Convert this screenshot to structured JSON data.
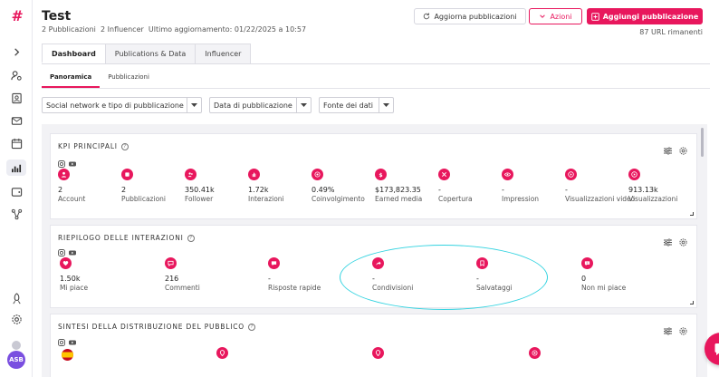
{
  "header": {
    "title": "Test",
    "publications_count": "2 Pubblicazioni",
    "influencer_count": "2 Influencer",
    "last_update": "Ultimo aggiornamento: 01/22/2025 a 10:57",
    "refresh_label": "Aggiorna pubblicazioni",
    "actions_label": "Azioni",
    "add_label": "Aggiungi pubblicazione",
    "url_remaining": "87 URL rimanenti"
  },
  "tabs": [
    "Dashboard",
    "Publications & Data",
    "Influencer"
  ],
  "subtabs": [
    "Panoramica",
    "Pubblicazioni"
  ],
  "filters": [
    "Social network e tipo di pubblicazione",
    "Data di pubblicazione",
    "Fonte dei dati"
  ],
  "kpi": {
    "title": "KPI PRINCIPALI",
    "items": [
      {
        "value": "2",
        "label": "Account",
        "icon": "user-icon"
      },
      {
        "value": "2",
        "label": "Pubblicazioni",
        "icon": "post-icon"
      },
      {
        "value": "350.41k",
        "label": "Follower",
        "icon": "followers-icon"
      },
      {
        "value": "1.72k",
        "label": "Interazioni",
        "icon": "hand-icon"
      },
      {
        "value": "0.49%",
        "label": "Coinvolgimento",
        "icon": "target-icon"
      },
      {
        "value": "$173,823.35",
        "label": "Earned media",
        "icon": "dollar-icon"
      },
      {
        "value": "-",
        "label": "Copertura",
        "icon": "cross-icon"
      },
      {
        "value": "-",
        "label": "Impression",
        "icon": "eye-icon"
      },
      {
        "value": "-",
        "label": "Visualizzazioni video",
        "icon": "play-icon"
      },
      {
        "value": "913.13k",
        "label": "Visualizzazioni",
        "icon": "play-icon"
      }
    ]
  },
  "interactions": {
    "title": "RIEPILOGO DELLE INTERAZIONI",
    "items": [
      {
        "value": "1.50k",
        "label": "Mi piace",
        "icon": "heart-icon"
      },
      {
        "value": "216",
        "label": "Commenti",
        "icon": "comment-icon"
      },
      {
        "value": "-",
        "label": "Risposte rapide",
        "icon": "quick-reply-icon"
      },
      {
        "value": "-",
        "label": "Condivisioni",
        "icon": "share-icon"
      },
      {
        "value": "-",
        "label": "Salvataggi",
        "icon": "bookmark-icon"
      },
      {
        "value": "0",
        "label": "Non mi piace",
        "icon": "dislike-icon"
      }
    ]
  },
  "audience": {
    "title": "SINTESI DELLA DISTRIBUZIONE DEL PUBBLICO"
  },
  "colors": {
    "accent": "#e8175d",
    "highlight": "#33d3e0"
  }
}
